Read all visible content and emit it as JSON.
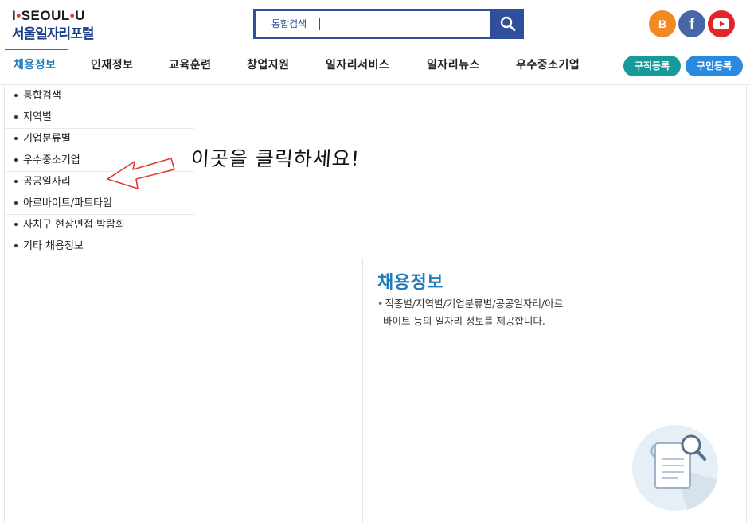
{
  "logo": {
    "top_text_a": "I",
    "top_dot_a": "•",
    "top_text_b": "SEOUL",
    "top_dot_b": "•",
    "top_text_c": "U",
    "bottom_text": "서울일자리포털"
  },
  "search": {
    "placeholder": "통합검색",
    "value": ""
  },
  "sns": {
    "blog_label": "B",
    "facebook_label": "f"
  },
  "gnb": {
    "items": [
      "채용정보",
      "인재정보",
      "교육훈련",
      "창업지원",
      "일자리서비스",
      "일자리뉴스",
      "우수중소기업"
    ],
    "active_index": 0,
    "seek_button": "구직등록",
    "hire_button": "구인등록"
  },
  "lnb": {
    "items": [
      "통합검색",
      "지역별",
      "기업분류별",
      "우수중소기업",
      "공공일자리",
      "아르바이트/파트타임",
      "자치구 현장면접 박람회",
      "기타 채용정보"
    ]
  },
  "annotation": {
    "text": "이곳을 클릭하세요!"
  },
  "content": {
    "title": "채용정보",
    "desc_mark": "•",
    "desc_line1": "직종별/지역별/기업분류별/공공일자리/아르",
    "desc_line2": "바이트 등의 일자리 정보를 제공합니다."
  },
  "colors": {
    "brand_blue": "#1f7dbd",
    "search_border": "#2f4f9c",
    "seek_button": "#199a9a",
    "hire_button": "#2a8ae0",
    "blog": "#f08b24",
    "facebook": "#4867a8",
    "youtube": "#e3242b",
    "annotation_arrow": "#e53935"
  },
  "icons": {
    "search": "search-icon",
    "youtube": "youtube-icon",
    "arrow": "arrow-left-icon",
    "document": "document-search-icon"
  }
}
